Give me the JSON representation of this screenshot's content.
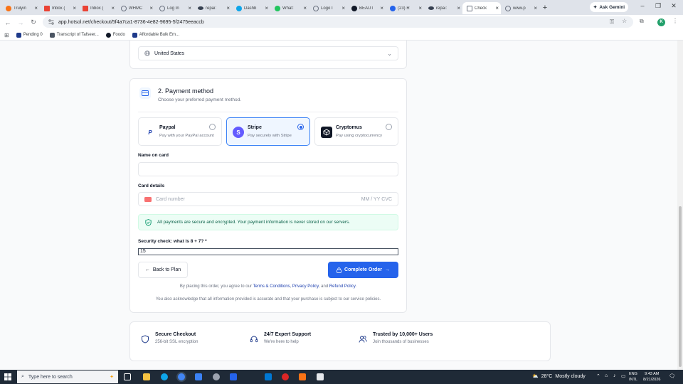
{
  "browser": {
    "tabs": [
      {
        "title": "Trulyin",
        "color": "#f97316"
      },
      {
        "title": "Inbox (",
        "color": "#ea4335"
      },
      {
        "title": "Inbox (",
        "color": "#ea4335"
      },
      {
        "title": "WHMC",
        "color": "#6b7280"
      },
      {
        "title": "Log In",
        "color": "#6b7280"
      },
      {
        "title": "repai:",
        "color": "#374151"
      },
      {
        "title": "Dashb",
        "color": "#0ea5e9"
      },
      {
        "title": "What:",
        "color": "#22c55e"
      },
      {
        "title": "Logo I",
        "color": "#6b7280"
      },
      {
        "title": "BEAUT",
        "color": "#111827"
      },
      {
        "title": "(23) R",
        "color": "#2563eb"
      },
      {
        "title": "repai:",
        "color": "#374151"
      },
      {
        "title": "Check",
        "color": "#6b7280",
        "active": true
      },
      {
        "title": "www.p",
        "color": "#6b7280"
      }
    ],
    "new_tab": "+",
    "ask_gemini": "Ask Gemini",
    "url": "app.hotsol.net/checkout/5f4a7ca1-8736-4e82-9695-5f2475eeaccb",
    "profile_initial": "K",
    "bookmarks": [
      {
        "label": "Pending 0",
        "color": "#1e3a8a"
      },
      {
        "label": "Transcript of Tafseer...",
        "color": "#4b5563"
      },
      {
        "label": "Foodo",
        "color": "#111827"
      },
      {
        "label": "Affordable Bulk Em...",
        "color": "#1e3a8a"
      }
    ]
  },
  "checkout": {
    "country_value": "United States",
    "payment": {
      "step_title": "2. Payment method",
      "subtitle": "Choose your preferred payment method.",
      "options": [
        {
          "name": "Paypal",
          "desc": "Pay with your PayPal account",
          "selected": false
        },
        {
          "name": "Stripe",
          "desc": "Pay securely with Stripe",
          "selected": true
        },
        {
          "name": "Cryptomus",
          "desc": "Pay using cryptocurrency",
          "selected": false
        }
      ]
    },
    "name_label": "Name on card",
    "name_value": "",
    "card_label": "Card details",
    "card_placeholder": "Card number",
    "card_exp_cvc": "MM / YY  CVC",
    "secure_note": "All payments are secure and encrypted. Your payment information is never stored on our servers.",
    "security_label": "Security check: what is 8 + 7? *",
    "security_value": "15",
    "back_label": "Back to Plan",
    "complete_label": "Complete Order",
    "legal": {
      "prefix": "By placing this order, you agree to our",
      "terms": "Terms & Conditions",
      "comma": ",",
      "privacy": "Privacy Policy",
      "and": ", and",
      "refund": "Refund Policy",
      "end": ".",
      "ack": "You also acknowledge that all information provided is accurate and that your purchase is subject to our service policies."
    },
    "features": [
      {
        "title": "Secure Checkout",
        "sub": "256-bit SSL encryption",
        "icon": "shield-icon"
      },
      {
        "title": "24/7 Expert Support",
        "sub": "We're here to help",
        "icon": "headset-icon"
      },
      {
        "title": "Trusted by 10,000+ Users",
        "sub": "Join thousands of businesses",
        "icon": "users-icon"
      }
    ]
  },
  "taskbar": {
    "search_placeholder": "Type here to search",
    "weather_temp": "28°C",
    "weather_text": "Mostly cloudy",
    "lang_1": "ENG",
    "lang_2": "INTL",
    "time": "9:43 AM",
    "date": "8/21/2026"
  },
  "colors": {
    "accent": "#2563eb",
    "success_bg": "#ecfdf5",
    "stripe": "#635bff"
  }
}
